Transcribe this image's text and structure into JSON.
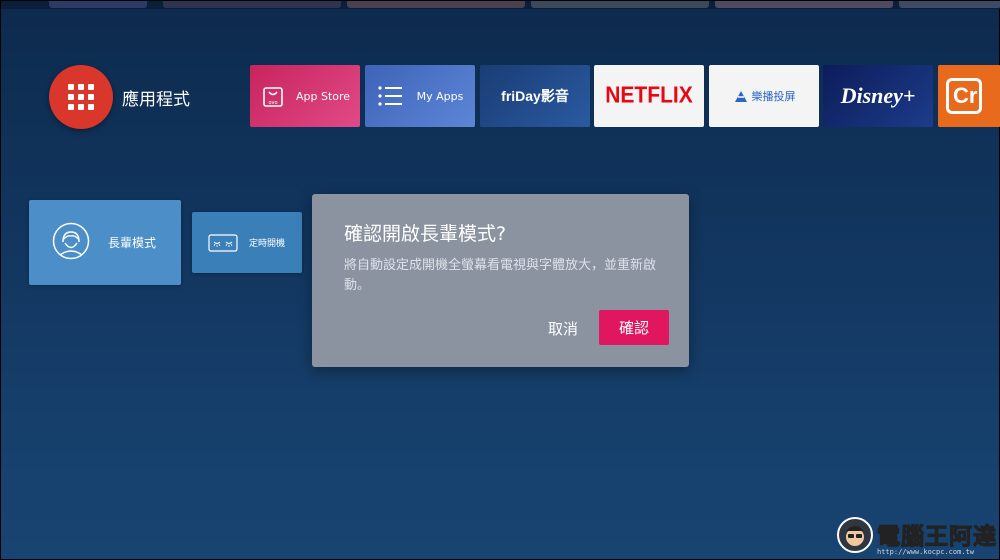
{
  "apps_row": {
    "title": "應用程式",
    "launcher_icon": "grid-icon",
    "tiles": [
      {
        "id": "app-store",
        "label": "App Store",
        "icon": "shopping-bag-icon"
      },
      {
        "id": "my-apps",
        "label": "My Apps",
        "icon": "list-icon"
      },
      {
        "id": "friday",
        "label": "friDay影音"
      },
      {
        "id": "netflix",
        "label": "NETFLIX"
      },
      {
        "id": "lebo",
        "label": "樂播投屏",
        "icon": "cast-icon"
      },
      {
        "id": "disney",
        "label": "Disney+"
      },
      {
        "id": "crunchy",
        "label": "Cr"
      }
    ]
  },
  "mode_tiles": {
    "senior": {
      "label": "長輩模式",
      "icon": "elder-face-icon"
    },
    "timer": {
      "label": "定時開機",
      "icon": "sleep-eyes-icon"
    }
  },
  "dialog": {
    "title": "確認開啟長輩模式?",
    "message": "將自動設定成開機全螢幕看電視與字體放大，並重新啟動。",
    "cancel_label": "取消",
    "confirm_label": "確認"
  },
  "watermark": {
    "title": "電腦王阿達",
    "url": "http://www.kocpc.com.tw"
  },
  "colors": {
    "launcher": "#d9362c",
    "confirm_button": "#e0175f",
    "dialog_bg": "#8b93a0",
    "netflix_red": "#e50914"
  }
}
